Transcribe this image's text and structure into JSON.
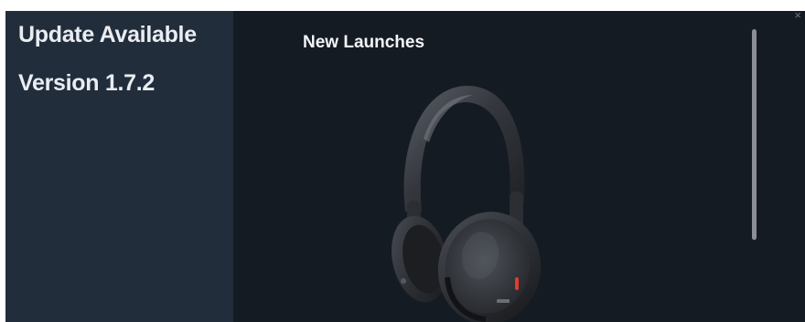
{
  "update_panel": {
    "title": "Update Available",
    "version": "Version 1.7.2"
  },
  "launches_panel": {
    "title": "New Launches",
    "product_image_icon": "over-ear-headphones-image",
    "close_glyph": "×"
  },
  "colors": {
    "left_panel": "#222d3b",
    "right_panel": "#151b23",
    "text": "#e9edf2",
    "scrollbar": "#8b8f95"
  }
}
